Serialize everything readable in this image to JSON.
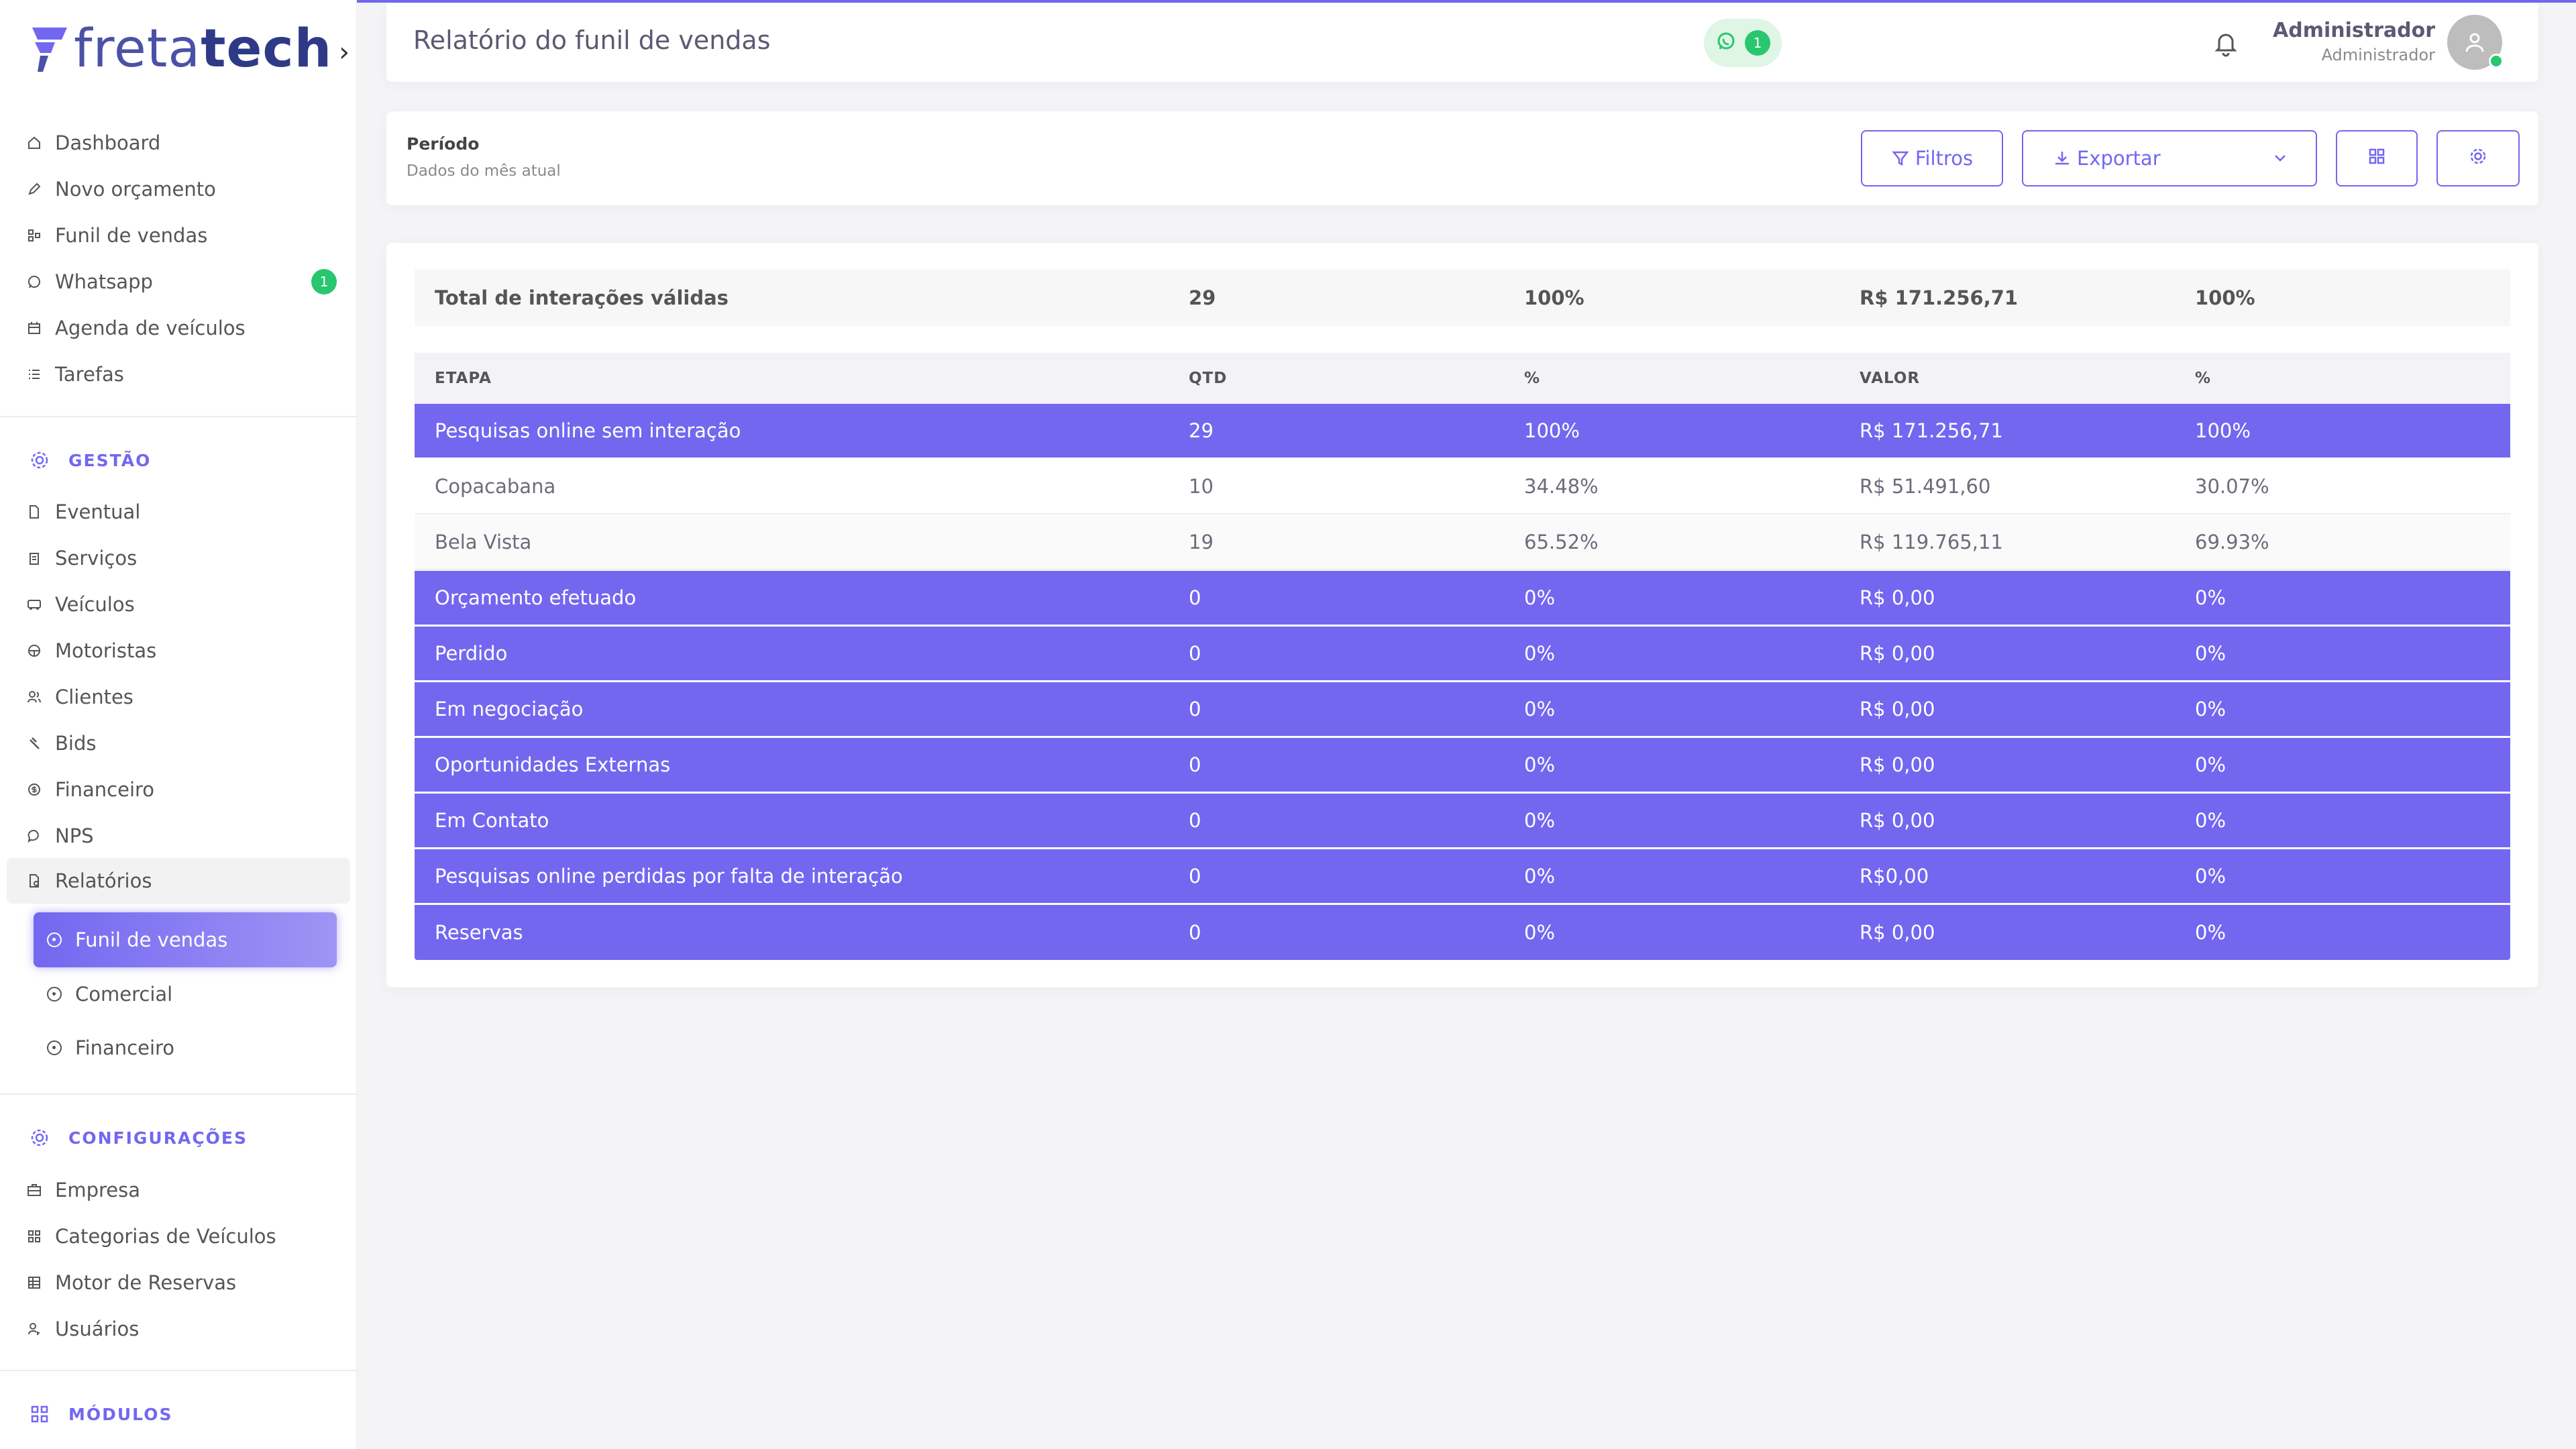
{
  "brand": {
    "logo_light": "freta",
    "logo_bold": "tech",
    "logo_colors": [
      "#7367f0",
      "#4b51a6",
      "#2f3a87"
    ]
  },
  "colors": {
    "accent": "#7367f0",
    "success": "#28c76f"
  },
  "sidebar": {
    "top_items": [
      {
        "label": "Dashboard",
        "icon": "home-icon"
      },
      {
        "label": "Novo orçamento",
        "icon": "edit-icon"
      },
      {
        "label": "Funil de vendas",
        "icon": "funnel-icon"
      },
      {
        "label": "Whatsapp",
        "icon": "whatsapp-icon",
        "badge": "1"
      },
      {
        "label": "Agenda de veículos",
        "icon": "calendar-icon"
      },
      {
        "label": "Tarefas",
        "icon": "list-icon"
      }
    ],
    "gestao": {
      "title": "GESTÃO",
      "items": [
        {
          "label": "Eventual",
          "icon": "file-icon"
        },
        {
          "label": "Serviços",
          "icon": "clipboard-icon"
        },
        {
          "label": "Veículos",
          "icon": "bus-icon"
        },
        {
          "label": "Motoristas",
          "icon": "steering-wheel-icon"
        },
        {
          "label": "Clientes",
          "icon": "users-icon"
        },
        {
          "label": "Bids",
          "icon": "gavel-icon"
        },
        {
          "label": "Financeiro",
          "icon": "dollar-icon"
        },
        {
          "label": "NPS",
          "icon": "chat-icon"
        },
        {
          "label": "Relatórios",
          "icon": "report-icon"
        }
      ],
      "sub_items": [
        {
          "label": "Funil de vendas",
          "active": true
        },
        {
          "label": "Comercial"
        },
        {
          "label": "Financeiro"
        }
      ]
    },
    "configuracoes": {
      "title": "CONFIGURAÇÕES",
      "items": [
        {
          "label": "Empresa",
          "icon": "briefcase-icon"
        },
        {
          "label": "Categorias de Veículos",
          "icon": "grid-icon"
        },
        {
          "label": "Motor de Reservas",
          "icon": "table-icon"
        },
        {
          "label": "Usuários",
          "icon": "user-key-icon"
        }
      ]
    },
    "modulos": {
      "title": "MÓDULOS"
    }
  },
  "header": {
    "title": "Relatório do funil de vendas",
    "whatsapp_count": "1",
    "user_name": "Administrador",
    "user_role": "Administrador"
  },
  "period": {
    "label": "Período",
    "description": "Dados do mês atual",
    "filters_label": "Filtros",
    "export_label": "Exportar"
  },
  "table": {
    "total": {
      "label": "Total de interações válidas",
      "qtd": "29",
      "pct": "100%",
      "valor": "R$ 171.256,71",
      "valor_pct": "100%"
    },
    "columns": [
      "ETAPA",
      "QTD",
      "%",
      "VALOR",
      "%"
    ],
    "rows": [
      {
        "etapa": "Pesquisas online sem interação",
        "qtd": "29",
        "pct": "100%",
        "valor": "R$ 171.256,71",
        "valor_pct": "100%",
        "kind": "stage"
      },
      {
        "etapa": "Copacabana",
        "qtd": "10",
        "pct": "34.48%",
        "valor": "R$ 51.491,60",
        "valor_pct": "30.07%",
        "kind": "branch"
      },
      {
        "etapa": "Bela Vista",
        "qtd": "19",
        "pct": "65.52%",
        "valor": "R$ 119.765,11",
        "valor_pct": "69.93%",
        "kind": "branch"
      },
      {
        "etapa": "Orçamento efetuado",
        "qtd": "0",
        "pct": "0%",
        "valor": "R$ 0,00",
        "valor_pct": "0%",
        "kind": "stage"
      },
      {
        "etapa": "Perdido",
        "qtd": "0",
        "pct": "0%",
        "valor": "R$ 0,00",
        "valor_pct": "0%",
        "kind": "stage"
      },
      {
        "etapa": "Em negociação",
        "qtd": "0",
        "pct": "0%",
        "valor": "R$ 0,00",
        "valor_pct": "0%",
        "kind": "stage"
      },
      {
        "etapa": "Oportunidades Externas",
        "qtd": "0",
        "pct": "0%",
        "valor": "R$ 0,00",
        "valor_pct": "0%",
        "kind": "stage"
      },
      {
        "etapa": "Em Contato",
        "qtd": "0",
        "pct": "0%",
        "valor": "R$ 0,00",
        "valor_pct": "0%",
        "kind": "stage"
      },
      {
        "etapa": "Pesquisas online perdidas por falta de interação",
        "qtd": "0",
        "pct": "0%",
        "valor": "R$0,00",
        "valor_pct": "0%",
        "kind": "stage"
      },
      {
        "etapa": "Reservas",
        "qtd": "0",
        "pct": "0%",
        "valor": "R$ 0,00",
        "valor_pct": "0%",
        "kind": "stage"
      }
    ]
  }
}
